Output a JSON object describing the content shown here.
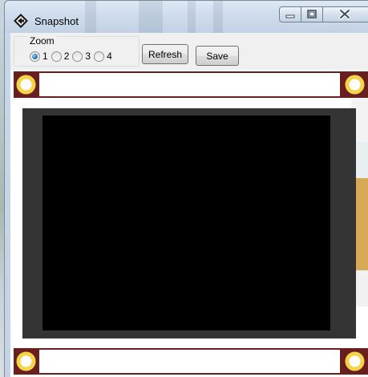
{
  "window": {
    "title": "Snapshot",
    "app_icon": "diamond-arrow-icon",
    "caption_buttons": [
      "minimize-icon",
      "maximize-icon",
      "close-icon"
    ]
  },
  "toolbar": {
    "zoom_group": {
      "label": "Zoom",
      "options": [
        {
          "label": "1",
          "checked": true
        },
        {
          "label": "2",
          "checked": false
        },
        {
          "label": "3",
          "checked": false
        },
        {
          "label": "4",
          "checked": false
        }
      ]
    },
    "refresh_label": "Refresh",
    "save_label": "Save"
  },
  "snapshot": {
    "screen_color": "#000000",
    "bezel_color": "#343434",
    "board_color": "#6a1f1f",
    "mount_hole_color": "#f5d44a"
  }
}
